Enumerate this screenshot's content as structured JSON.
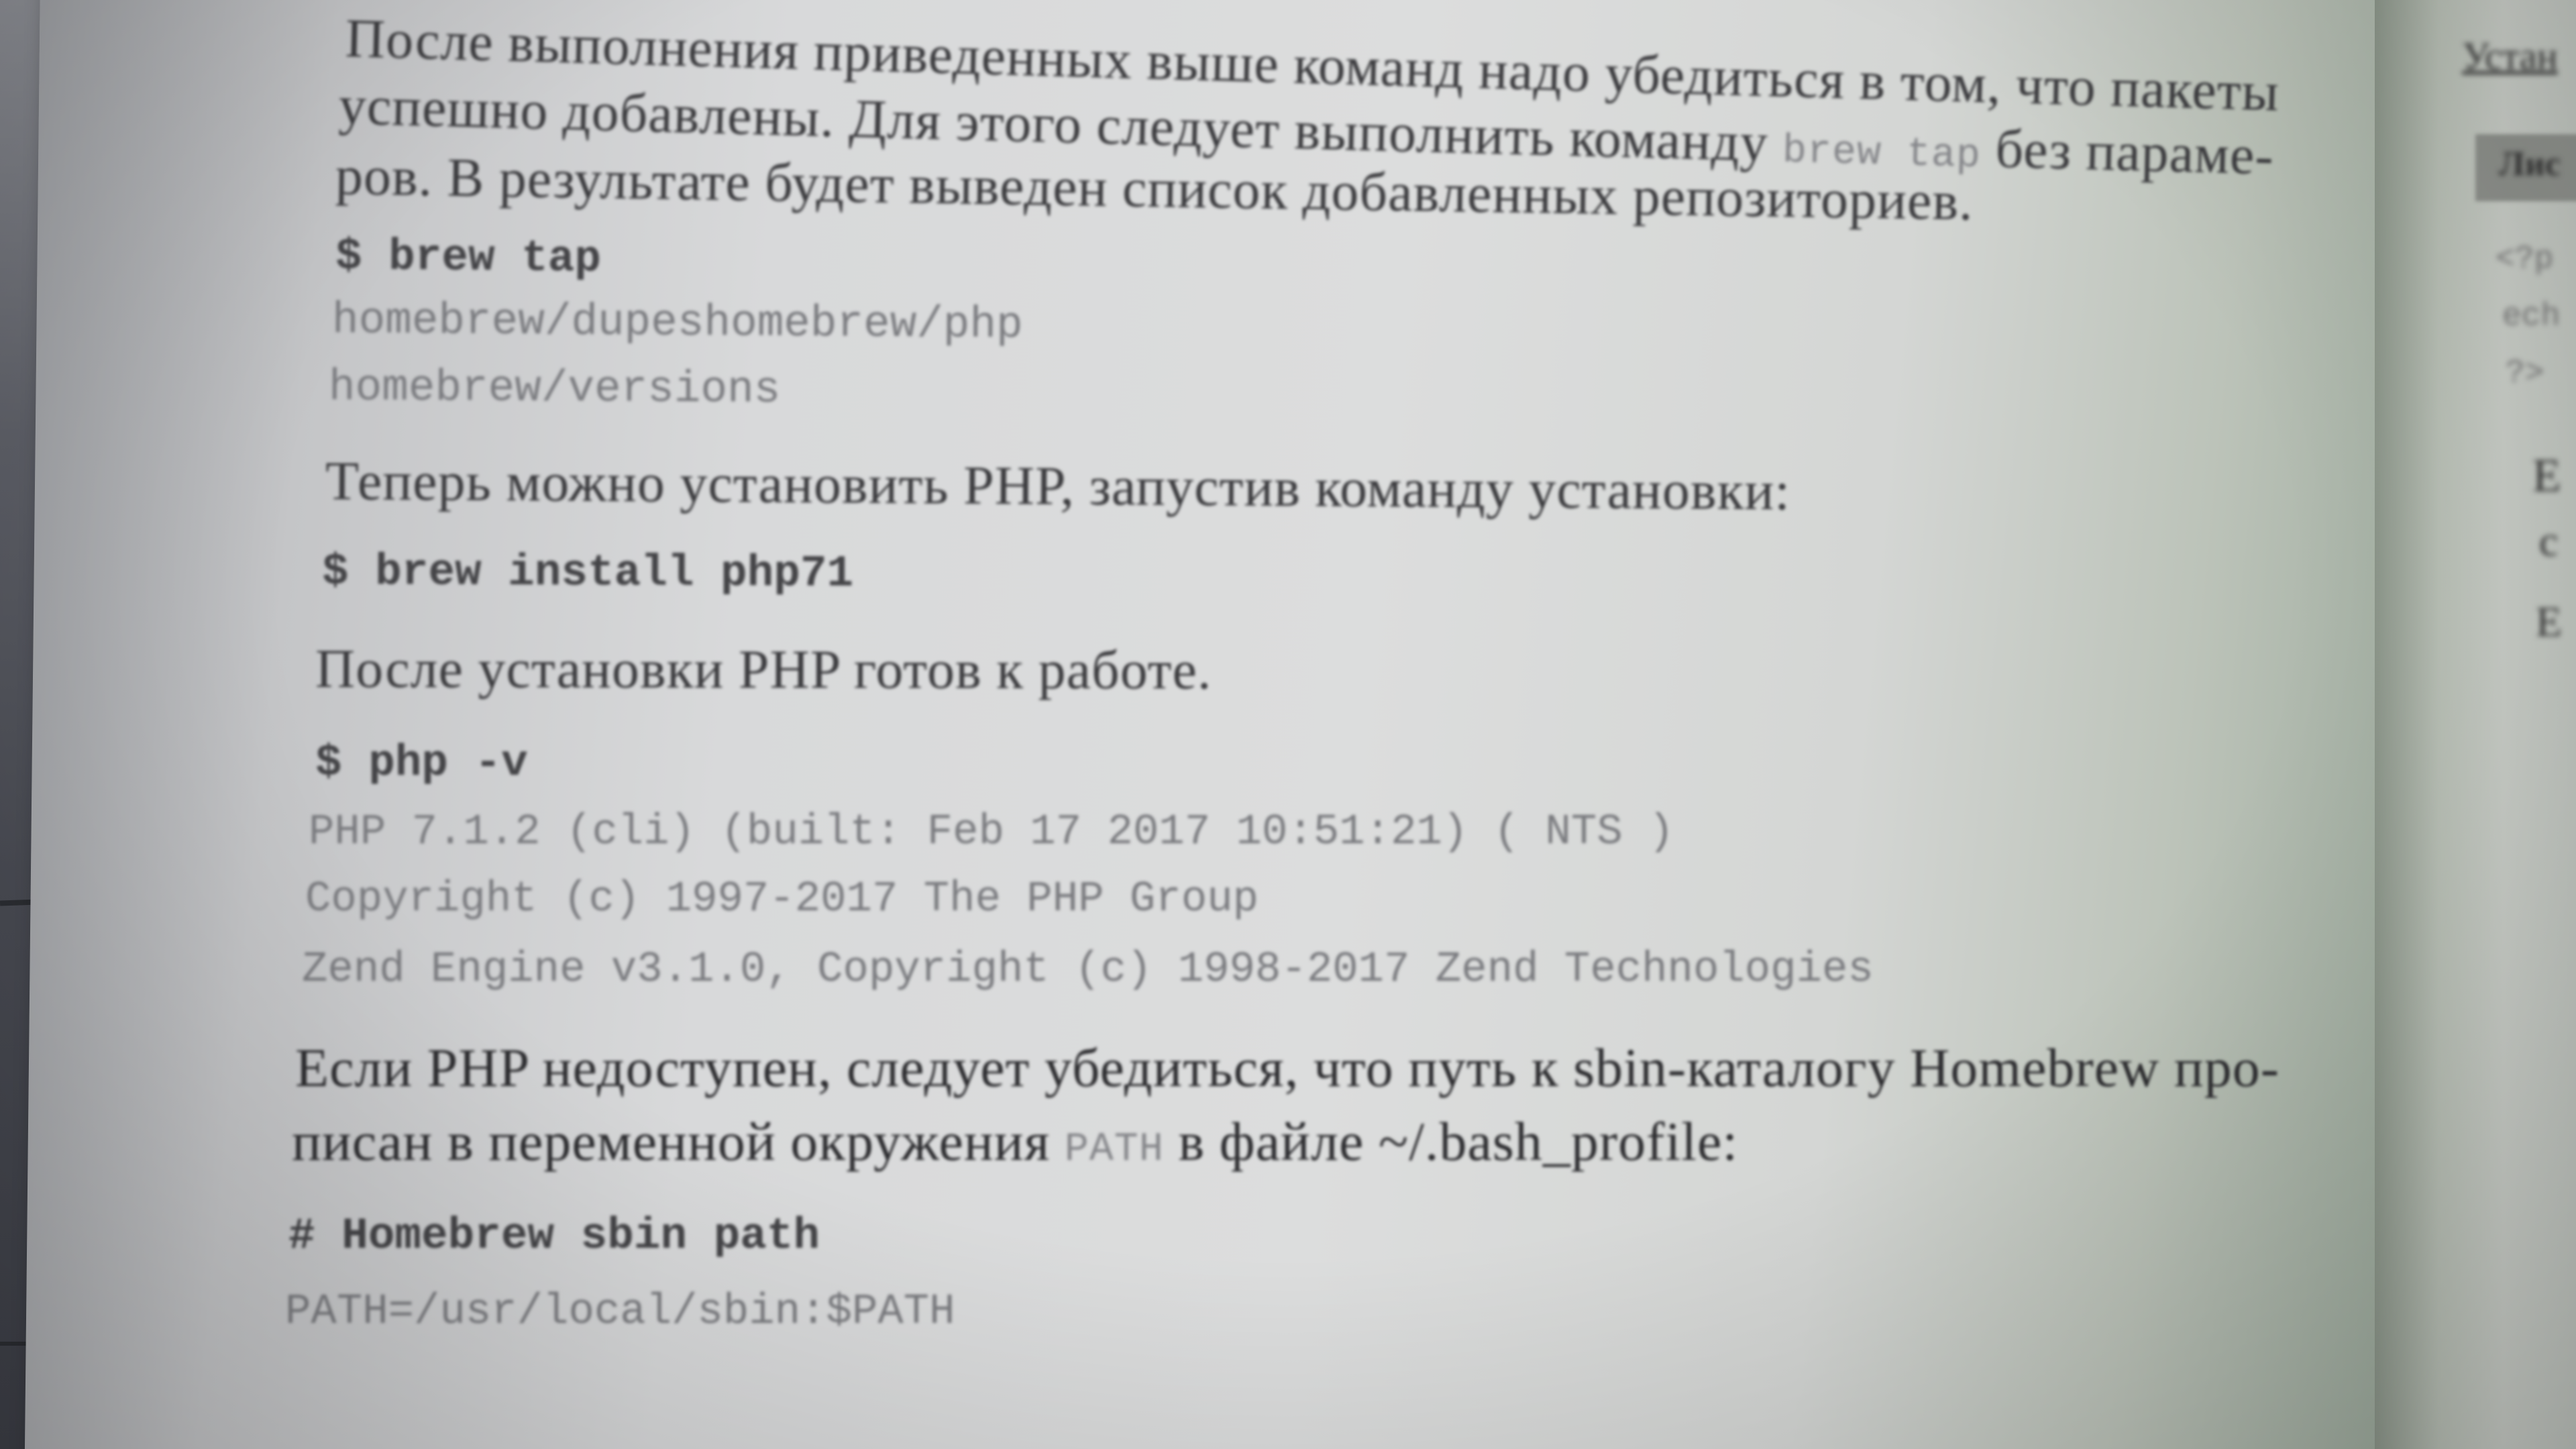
{
  "book_page": {
    "paragraph_1": {
      "line_1": "После выполнения приведенных выше команд надо убедиться в том, что пакеты",
      "line_2_before_code": "успешно добавлены. Для этого следует выполнить команду ",
      "line_2_code": "brew tap",
      "line_2_after_code": " без параме-",
      "line_3": "ров. В результате будет выведен список добавленных репозиториев."
    },
    "code_block_1": {
      "command": "$ brew tap",
      "output": [
        "homebrew/dupeshomebrew/php",
        "homebrew/versions"
      ]
    },
    "paragraph_2": "Теперь можно установить PHP, запустив команду установки:",
    "code_block_2": {
      "command": "$ brew install php71"
    },
    "paragraph_3": "После установки PHP готов к работе.",
    "code_block_3": {
      "command": "$ php -v",
      "output": [
        "PHP 7.1.2 (cli) (built: Feb 17 2017 10:51:21) ( NTS )",
        "Copyright (c) 1997-2017 The PHP Group",
        "Zend Engine v3.1.0, Copyright (c) 1998-2017 Zend Technologies"
      ]
    },
    "paragraph_4": {
      "line_1": "Если PHP недоступен, следует убедиться, что путь к sbin-каталогу Homebrew про-",
      "line_2_before_code": "писан в переменной окружения ",
      "line_2_code": "PATH",
      "line_2_after_code": " в файле ~/.bash_profile:"
    },
    "code_block_4": {
      "comment": "# Homebrew sbin path",
      "line": "PATH=/usr/local/sbin:$PATH"
    }
  },
  "adjacent_page_fragments": [
    "Устан",
    "Лис",
    "<?p",
    "ech",
    "?>",
    "Е",
    "с",
    "Е"
  ]
}
